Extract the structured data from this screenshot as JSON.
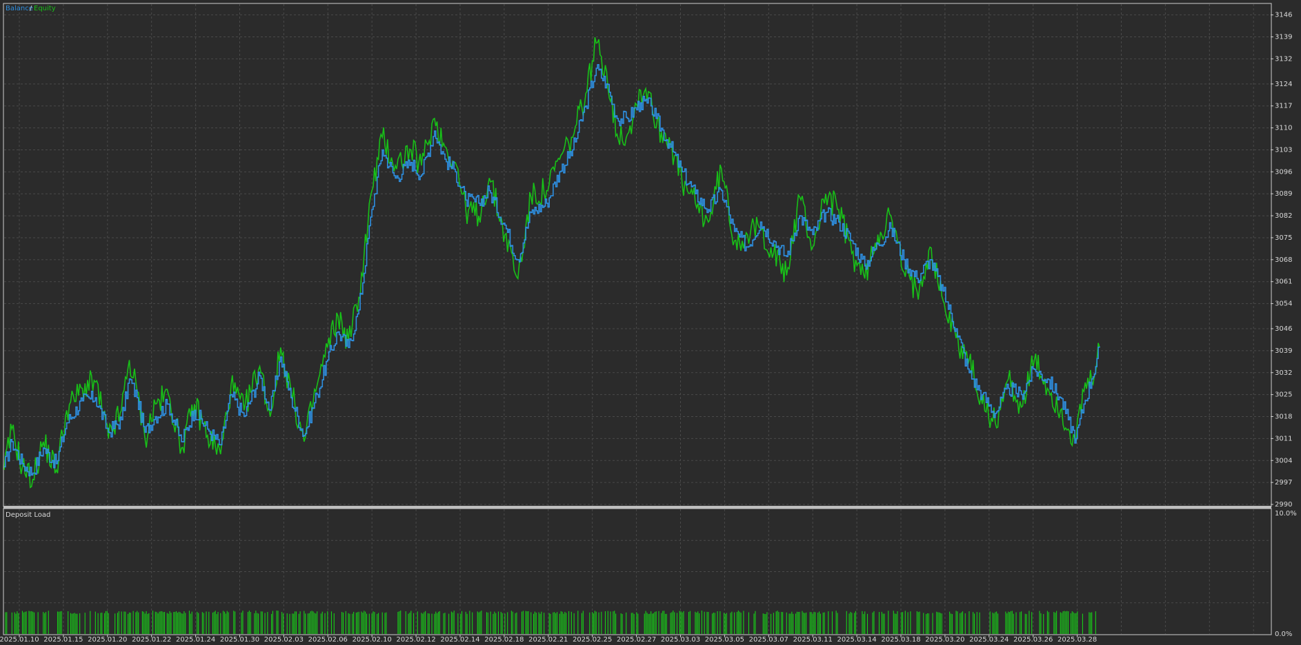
{
  "colors": {
    "background": "#2b2b2b",
    "frame": "#d0d0d0",
    "grid": "#4a4a4a",
    "text": "#d8d8d8",
    "balance": "#2e8fe0",
    "equity": "#18c018",
    "deposit_load": "#18d018",
    "separator": "#bdbdbd"
  },
  "chart_data": [
    {
      "type": "line",
      "legend": {
        "placement": "top-left",
        "items": [
          "Balance",
          "Equity"
        ],
        "separator": "/"
      },
      "grid": true,
      "y_axis": {
        "position": "right",
        "ylim": [
          2990,
          3149
        ],
        "ticks": [
          "3146",
          "3139",
          "3132",
          "3124",
          "3117",
          "3110",
          "3103",
          "3096",
          "3089",
          "3082",
          "3075",
          "3068",
          "3061",
          "3054",
          "3046",
          "3039",
          "3032",
          "3025",
          "3018",
          "3011",
          "3004",
          "2997",
          "2990"
        ]
      },
      "x_axis": {
        "ticks": [
          "2025.01.10",
          "2025.01.15",
          "2025.01.20",
          "2025.01.22",
          "2025.01.24",
          "2025.01.30",
          "2025.02.03",
          "2025.02.06",
          "2025.02.10",
          "2025.02.12",
          "2025.02.14",
          "2025.02.18",
          "2025.02.21",
          "2025.02.25",
          "2025.02.27",
          "2025.03.03",
          "2025.03.05",
          "2025.03.07",
          "2025.03.11",
          "2025.03.14",
          "2025.03.18",
          "2025.03.20",
          "2025.03.24",
          "2025.03.26",
          "2025.03.28"
        ]
      },
      "x_range_trades": [
        0,
        500
      ],
      "series": [
        {
          "name": "Balance",
          "anchors": [
            [
              0,
              3002
            ],
            [
              6,
              3010
            ],
            [
              14,
              3003
            ],
            [
              22,
              3000
            ],
            [
              30,
              3008
            ],
            [
              40,
              3003
            ],
            [
              48,
              3016
            ],
            [
              60,
              3023
            ],
            [
              70,
              3024
            ],
            [
              80,
              3013
            ],
            [
              90,
              3017
            ],
            [
              96,
              3030
            ],
            [
              102,
              3024
            ],
            [
              108,
              3013
            ],
            [
              116,
              3018
            ],
            [
              126,
              3022
            ],
            [
              136,
              3010
            ],
            [
              146,
              3020
            ],
            [
              156,
              3014
            ],
            [
              166,
              3009
            ],
            [
              174,
              3025
            ],
            [
              184,
              3018
            ],
            [
              196,
              3031
            ],
            [
              204,
              3020
            ],
            [
              212,
              3037
            ],
            [
              220,
              3024
            ],
            [
              230,
              3012
            ],
            [
              240,
              3025
            ],
            [
              248,
              3036
            ],
            [
              256,
              3045
            ],
            [
              264,
              3040
            ],
            [
              272,
              3052
            ],
            [
              282,
              3084
            ],
            [
              290,
              3103
            ],
            [
              300,
              3094
            ],
            [
              312,
              3099
            ],
            [
              320,
              3095
            ],
            [
              330,
              3109
            ],
            [
              338,
              3100
            ],
            [
              346,
              3096
            ],
            [
              354,
              3087
            ],
            [
              364,
              3086
            ],
            [
              372,
              3090
            ],
            [
              384,
              3079
            ],
            [
              394,
              3068
            ],
            [
              404,
              3083
            ],
            [
              416,
              3086
            ],
            [
              426,
              3096
            ],
            [
              436,
              3103
            ],
            [
              446,
              3117
            ],
            [
              454,
              3129
            ],
            [
              462,
              3124
            ],
            [
              470,
              3113
            ],
            [
              478,
              3113
            ],
            [
              488,
              3118
            ],
            [
              496,
              3117
            ],
            [
              500,
              3113
            ]
          ]
        },
        {
          "name": "Equity",
          "note_visible_offset": "Equity tracks Balance with larger excursions",
          "anchors": [
            [
              0,
              3001
            ],
            [
              6,
              3014
            ],
            [
              14,
              3002
            ],
            [
              22,
              2998
            ],
            [
              30,
              3010
            ],
            [
              40,
              3001
            ],
            [
              48,
              3020
            ],
            [
              60,
              3027
            ],
            [
              70,
              3029
            ],
            [
              80,
              3011
            ],
            [
              90,
              3020
            ],
            [
              96,
              3036
            ],
            [
              102,
              3026
            ],
            [
              108,
              3011
            ],
            [
              116,
              3022
            ],
            [
              126,
              3025
            ],
            [
              136,
              3008
            ],
            [
              146,
              3022
            ],
            [
              156,
              3012
            ],
            [
              166,
              3006
            ],
            [
              174,
              3028
            ],
            [
              184,
              3020
            ],
            [
              196,
              3034
            ],
            [
              204,
              3018
            ],
            [
              212,
              3040
            ],
            [
              220,
              3026
            ],
            [
              230,
              3010
            ],
            [
              240,
              3028
            ],
            [
              248,
              3040
            ],
            [
              256,
              3050
            ],
            [
              264,
              3042
            ],
            [
              272,
              3056
            ],
            [
              282,
              3090
            ],
            [
              290,
              3107
            ],
            [
              300,
              3098
            ],
            [
              312,
              3103
            ],
            [
              320,
              3098
            ],
            [
              330,
              3113
            ],
            [
              338,
              3104
            ],
            [
              346,
              3099
            ],
            [
              354,
              3084
            ],
            [
              364,
              3082
            ],
            [
              372,
              3094
            ],
            [
              384,
              3076
            ],
            [
              394,
              3062
            ],
            [
              404,
              3088
            ],
            [
              416,
              3090
            ],
            [
              426,
              3100
            ],
            [
              436,
              3107
            ],
            [
              446,
              3121
            ],
            [
              454,
              3137
            ],
            [
              462,
              3128
            ],
            [
              470,
              3108
            ],
            [
              478,
              3108
            ],
            [
              488,
              3122
            ],
            [
              496,
              3121
            ],
            [
              500,
              3110
            ]
          ]
        }
      ],
      "series_part2": {
        "Balance": [
          [
            500,
            3113
          ],
          [
            510,
            3105
          ],
          [
            520,
            3096
          ],
          [
            530,
            3089
          ],
          [
            540,
            3084
          ],
          [
            550,
            3090
          ],
          [
            560,
            3077
          ],
          [
            570,
            3072
          ],
          [
            580,
            3080
          ],
          [
            590,
            3074
          ],
          [
            600,
            3069
          ],
          [
            610,
            3082
          ],
          [
            620,
            3076
          ],
          [
            630,
            3083
          ],
          [
            640,
            3080
          ],
          [
            650,
            3074
          ],
          [
            660,
            3066
          ],
          [
            670,
            3073
          ],
          [
            680,
            3078
          ],
          [
            690,
            3068
          ],
          [
            700,
            3062
          ],
          [
            710,
            3068
          ],
          [
            720,
            3058
          ],
          [
            730,
            3046
          ],
          [
            740,
            3032
          ],
          [
            750,
            3025
          ],
          [
            760,
            3019
          ],
          [
            770,
            3027
          ],
          [
            780,
            3025
          ],
          [
            790,
            3033
          ],
          [
            800,
            3030
          ],
          [
            810,
            3024
          ],
          [
            816,
            3017
          ],
          [
            822,
            3011
          ],
          [
            828,
            3022
          ],
          [
            834,
            3030
          ],
          [
            840,
            3040
          ]
        ],
        "Equity": [
          [
            500,
            3110
          ],
          [
            510,
            3107
          ],
          [
            520,
            3092
          ],
          [
            530,
            3086
          ],
          [
            540,
            3080
          ],
          [
            550,
            3097
          ],
          [
            560,
            3074
          ],
          [
            570,
            3076
          ],
          [
            580,
            3078
          ],
          [
            590,
            3070
          ],
          [
            600,
            3063
          ],
          [
            610,
            3088
          ],
          [
            620,
            3072
          ],
          [
            630,
            3089
          ],
          [
            640,
            3084
          ],
          [
            650,
            3070
          ],
          [
            660,
            3062
          ],
          [
            670,
            3076
          ],
          [
            680,
            3082
          ],
          [
            690,
            3064
          ],
          [
            700,
            3058
          ],
          [
            710,
            3072
          ],
          [
            720,
            3055
          ],
          [
            730,
            3043
          ],
          [
            740,
            3036
          ],
          [
            750,
            3022
          ],
          [
            760,
            3016
          ],
          [
            770,
            3030
          ],
          [
            780,
            3021
          ],
          [
            790,
            3036
          ],
          [
            800,
            3027
          ],
          [
            810,
            3020
          ],
          [
            816,
            3014
          ],
          [
            822,
            3010
          ],
          [
            828,
            3026
          ],
          [
            834,
            3029
          ],
          [
            840,
            3040
          ]
        ]
      }
    },
    {
      "type": "bar",
      "title": "Deposit Load",
      "grid": true,
      "y_axis": {
        "position": "right",
        "ylim": [
          0,
          10
        ],
        "ticks": [
          "10.0%",
          "0.0%"
        ]
      },
      "bar_span_trades": [
        0,
        840
      ],
      "typical_value_percent": 1.9
    }
  ]
}
